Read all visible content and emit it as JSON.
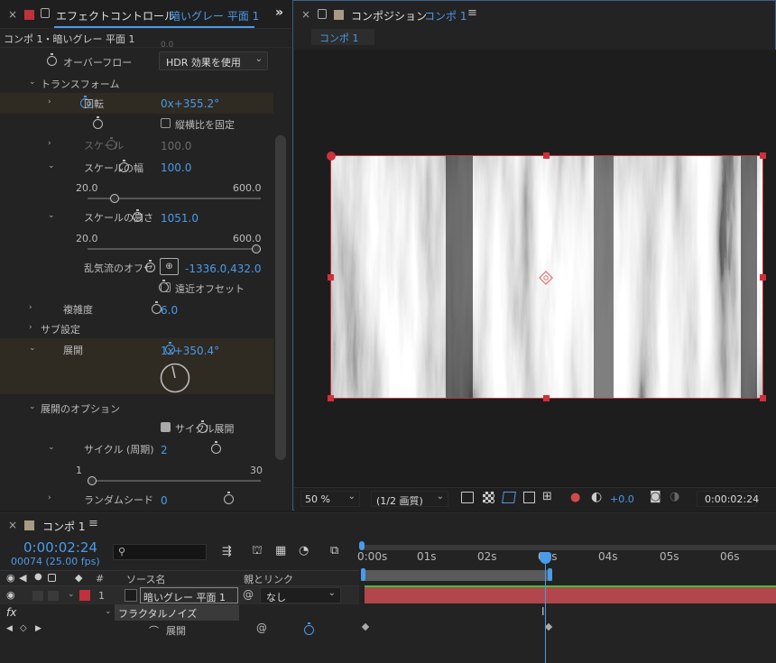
{
  "effect_panel": {
    "tab_title": "エフェクトコントロール",
    "tab_title_layer": "暗いグレー 平面 1",
    "breadcrumb": "コンポ 1・暗いグレー 平面 1",
    "cut_value": "0.0",
    "overflow_label": "オーバーフロー",
    "overflow_value": "HDR 効果を使用",
    "transform_label": "トランスフォーム",
    "rotation_label": "回転",
    "rotation_value": "0x+355.2°",
    "uniform_scale_label": "縦横比を固定",
    "scale_label": "スケール",
    "scale_value": "100.0",
    "scale_width_label": "スケールの幅",
    "scale_width_value": "100.0",
    "scale_width_min": "20.0",
    "scale_width_max": "600.0",
    "scale_width_slider_fraction": 0.14,
    "scale_height_label": "スケールの高さ",
    "scale_height_value": "1051.0",
    "scale_height_min": "20.0",
    "scale_height_max": "600.0",
    "scale_height_slider_fraction": 1.0,
    "offset_label": "乱気流のオフセ",
    "offset_value": "-1336.0,432.0",
    "perspective_label": "遠近オフセット",
    "complexity_label": "複雑度",
    "complexity_value": "6.0",
    "sub_settings_label": "サブ設定",
    "evolution_label": "展開",
    "evolution_value": "1x+350.4°",
    "evolution_options_label": "展開のオプション",
    "cycle_evolution_label": "サイクル展開",
    "cycle_label": "サイクル (周期)",
    "cycle_value": "2",
    "cycle_min": "1",
    "cycle_max": "30",
    "cycle_slider_fraction": 0.0,
    "random_seed_label": "ランダムシード",
    "random_seed_value": "0"
  },
  "comp_panel": {
    "tab_title": "コンポジション",
    "tab_title_comp": "コンポ 1",
    "comp_tab": "コンポ 1",
    "zoom": "50 %",
    "resolution": "(1/2 画質)",
    "exposure": "+0.0",
    "timecode": "0:00:02:24"
  },
  "timeline": {
    "tab_title": "コンポ 1",
    "timecode": "0:00:02:24",
    "frame_info": "00074 (25.00 fps)",
    "search_placeholder": "",
    "col_number": "#",
    "col_source": "ソース名",
    "col_parent": "親とリンク",
    "layer_number": "1",
    "layer_name": "暗いグレー 平面 1",
    "parent_value": "なし",
    "effect_name": "フラクタルノイズ",
    "fx_label": "fx",
    "property_name": "展開",
    "ruler": [
      "0:00s",
      "01s",
      "02s",
      "03s",
      "04s",
      "05s",
      "06s"
    ]
  },
  "colors": {
    "accent": "#4a9bea",
    "label_red": "#c0313b",
    "layer_bar": "#b1474c",
    "handle": "#d0303a"
  }
}
